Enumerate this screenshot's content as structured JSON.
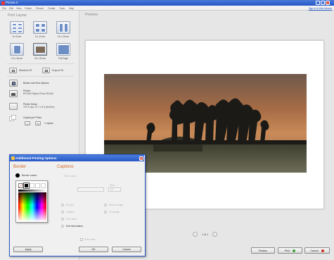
{
  "app": {
    "title": "Picasa 3",
    "minimize": "_",
    "maximize": "□",
    "close": "×"
  },
  "menu": {
    "items": [
      "File",
      "Edit",
      "View",
      "Folder",
      "Picture",
      "Create",
      "Tools",
      "Help"
    ],
    "sign_in": "Sign In to Web Albums"
  },
  "left": {
    "print_layout_title": "Print Layout",
    "layouts": [
      {
        "label": "5 x 8 cm"
      },
      {
        "label": "9 x 13 cm"
      },
      {
        "label": "10 x 15 cm"
      },
      {
        "label": "13 x 18 cm"
      },
      {
        "label": "20 x 25 cm"
      },
      {
        "label": "Full Page"
      }
    ],
    "shrink_to_fit": "Shrink to Fit",
    "crop_to_fit": "Crop to Fit",
    "border_text_options": "Border and Text Options",
    "printer_label": "Printer:",
    "printer_name": "EPSON Stylus Photo R2400",
    "printer_setup": "Printer Setup",
    "printer_setup_detail": "720 X dpi, 11.7 x 8.3 (A4/Dm)",
    "copies_label": "Copies per Photo",
    "copies_minus": "-",
    "copies_plus": "+",
    "copies_value": "1 copies"
  },
  "preview": {
    "title": "Preview",
    "page_indicator": "1 of 1",
    "prev": "‹",
    "next": "›"
  },
  "buttons": {
    "review": "Review",
    "print": "Print",
    "cancel": "Cancel"
  },
  "dialog": {
    "title": "Additional Printing Options",
    "close": "X",
    "border_head": "Border",
    "border_colour": "Border colour",
    "captions_head": "Captions",
    "text_colour": "Text Colour",
    "size_label": "Size",
    "size_value": "10",
    "no_text": "No text",
    "caption": "Caption",
    "file_name": "File name",
    "exif_information": "Exif information",
    "above_image": "Above image",
    "on_image": "On image",
    "show_text": "Show text",
    "apply": "Apply",
    "ok": "OK",
    "cancel": "Cancel"
  },
  "colors": {
    "accent_orange": "#d0682a",
    "titlebar_blue": "#2858c4",
    "print_icon": "#3aa53a",
    "cancel_icon": "#cc3322"
  }
}
